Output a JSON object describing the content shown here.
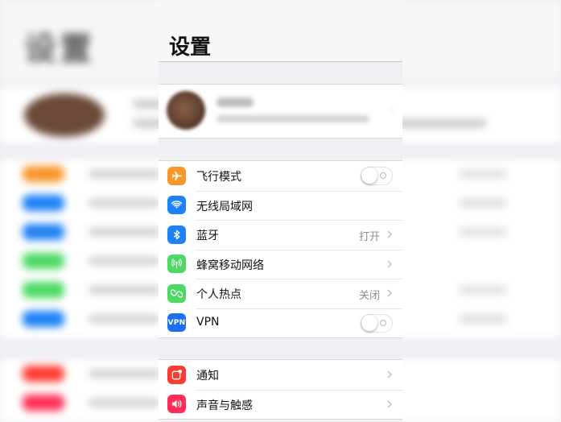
{
  "header": {
    "title": "设置"
  },
  "groups": {
    "connectivity": [
      {
        "label": "飞行模式",
        "icon": "airplane-icon",
        "color": "#f7962a",
        "toggle": false
      },
      {
        "label": "无线局域网",
        "icon": "wifi-icon",
        "color": "#1e81f5"
      },
      {
        "label": "蓝牙",
        "icon": "bluetooth-icon",
        "color": "#1e81f5",
        "value": "打开"
      },
      {
        "label": "蜂窝移动网络",
        "icon": "cellular-icon",
        "color": "#4cd964"
      },
      {
        "label": "个人热点",
        "icon": "hotspot-icon",
        "color": "#4cd964",
        "value": "关闭"
      },
      {
        "label": "VPN",
        "icon": "vpn-icon",
        "color": "#1e6ff0",
        "icon_text": "VPN",
        "toggle": false
      }
    ],
    "notifications": [
      {
        "label": "通知",
        "icon": "notifications-icon",
        "color": "#fe3b30"
      },
      {
        "label": "声音与触感",
        "icon": "sound-icon",
        "color": "#fe2d55"
      }
    ]
  }
}
